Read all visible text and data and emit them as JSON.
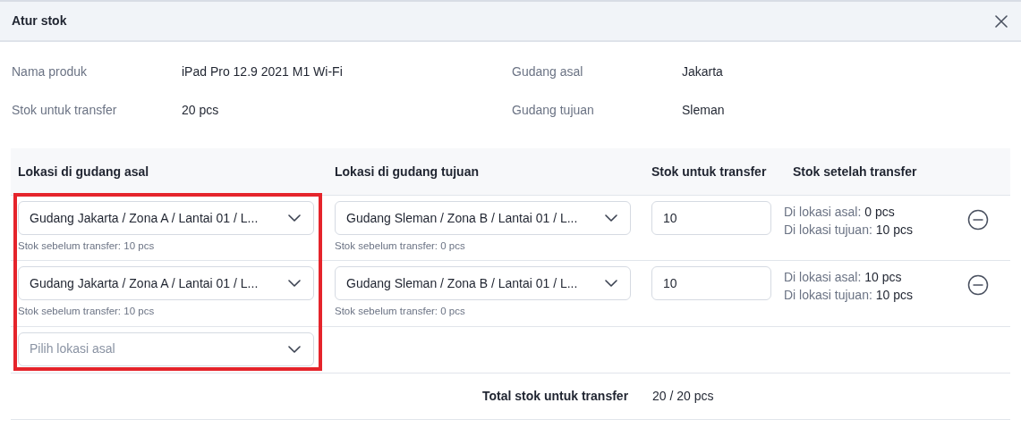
{
  "dialog": {
    "title": "Atur stok"
  },
  "info": [
    {
      "label": "Nama produk",
      "value": "iPad Pro 12.9 2021 M1 Wi-Fi"
    },
    {
      "label": "Gudang asal",
      "value": "Jakarta"
    },
    {
      "label": "Stok untuk transfer",
      "value": "20 pcs"
    },
    {
      "label": "Gudang tujuan",
      "value": "Sleman"
    }
  ],
  "table": {
    "columns": [
      "Lokasi di gudang asal",
      "Lokasi di gudang tujuan",
      "Stok untuk transfer",
      "Stok setelah transfer"
    ],
    "rows": [
      {
        "source": {
          "value": "Gudang Jakarta / Zona A / Lantai 01 / L...",
          "note": "Stok sebelum transfer: 10 pcs"
        },
        "destination": {
          "value": "Gudang Sleman / Zona B / Lantai 01 / L...",
          "note": "Stok sebelum transfer: 0 pcs"
        },
        "quantity": "10",
        "after": [
          {
            "label": "Di lokasi asal:",
            "value": "0 pcs"
          },
          {
            "label": "Di lokasi tujuan:",
            "value": "10 pcs"
          }
        ]
      },
      {
        "source": {
          "value": "Gudang Jakarta / Zona A / Lantai 01 / L...",
          "note": "Stok sebelum transfer: 10 pcs"
        },
        "destination": {
          "value": "Gudang Sleman / Zona B / Lantai 01 / L...",
          "note": "Stok sebelum transfer: 0 pcs"
        },
        "quantity": "10",
        "after": [
          {
            "label": "Di lokasi asal:",
            "value": "10 pcs"
          },
          {
            "label": "Di lokasi tujuan:",
            "value": "10 pcs"
          }
        ]
      }
    ],
    "new_row": {
      "placeholder": "Pilih lokasi asal"
    },
    "total": {
      "label": "Total stok untuk transfer",
      "value": "20 / 20 pcs"
    }
  }
}
